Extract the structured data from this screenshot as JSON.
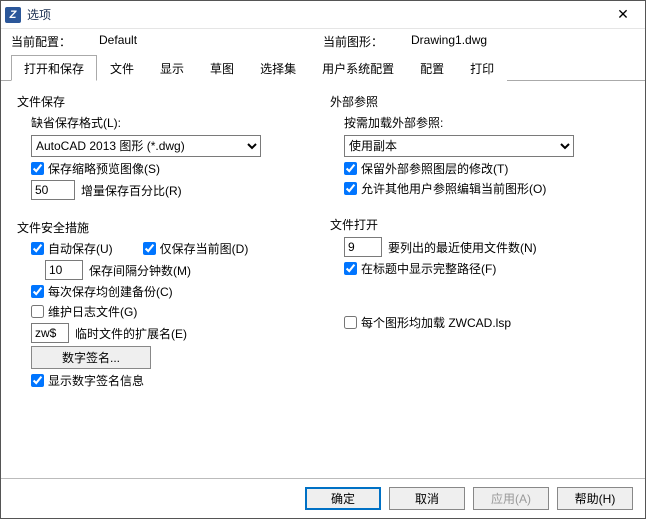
{
  "title": "选项",
  "close_x": "✕",
  "profile_label": "当前配置：",
  "profile_value": "Default",
  "drawing_label": "当前图形：",
  "drawing_value": "Drawing1.dwg",
  "tabs": [
    "打开和保存",
    "文件",
    "显示",
    "草图",
    "选择集",
    "用户系统配置",
    "配置",
    "打印"
  ],
  "left": {
    "file_save": {
      "title": "文件保存",
      "format_label": "缺省保存格式(L):",
      "format_value": "AutoCAD 2013 图形 (*.dwg)",
      "thumbnail_cb": "保存缩略预览图像(S)",
      "increment_value": "50",
      "increment_label": "增量保存百分比(R)"
    },
    "safety": {
      "title": "文件安全措施",
      "autosave_cb": "自动保存(U)",
      "current_only_cb": "仅保存当前图(D)",
      "interval_value": "10",
      "interval_label": "保存间隔分钟数(M)",
      "backup_cb": "每次保存均创建备份(C)",
      "log_cb": "维护日志文件(G)",
      "temp_ext_value": "zw$",
      "temp_ext_label": "临时文件的扩展名(E)",
      "digital_sig_btn": "数字签名...",
      "show_digisig_cb": "显示数字签名信息"
    }
  },
  "right": {
    "xref": {
      "title": "外部参照",
      "load_label": "按需加载外部参照:",
      "load_value": "使用副本",
      "keep_layers_cb": "保留外部参照图层的修改(T)",
      "allow_edit_cb": "允许其他用户参照编辑当前图形(O)"
    },
    "open": {
      "title": "文件打开",
      "recent_value": "9",
      "recent_label": "要列出的最近使用文件数(N)",
      "fullpath_cb": "在标题中显示完整路径(F)"
    },
    "lsp_cb": "每个图形均加载 ZWCAD.lsp"
  },
  "footer": {
    "ok": "确定",
    "cancel": "取消",
    "apply": "应用(A)",
    "help": "帮助(H)"
  }
}
